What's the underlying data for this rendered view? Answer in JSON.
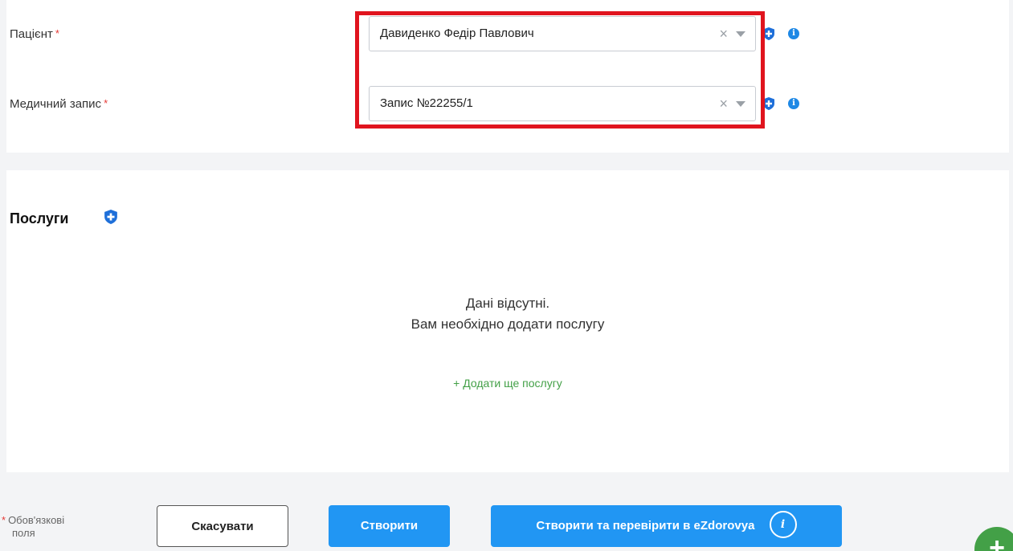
{
  "form": {
    "patient": {
      "label": "Пацієнт",
      "required_mark": "*",
      "value": "Давиденко Федір Павлович",
      "clear_glyph": "×"
    },
    "medical_record": {
      "label": "Медичний запис",
      "required_mark": "*",
      "value": "Запис №22255/1",
      "clear_glyph": "×"
    }
  },
  "services": {
    "title": "Послуги",
    "empty_line1": "Дані відсутні.",
    "empty_line2": "Вам необхідно додати послугу",
    "add_link": "+ Додати ще послугу"
  },
  "footer": {
    "required_star": "*",
    "required_line1": "Обов'язкові",
    "required_line2": "поля",
    "cancel_label": "Скасувати",
    "create_label": "Створити",
    "create_check_label": "Створити та перевірити в eZdorovya",
    "create_check_info": "i"
  },
  "fab": {
    "label": "+"
  },
  "icons": {
    "shield": "shield-plus-icon",
    "info": "info-icon",
    "dropdown": "chevron-down-icon",
    "clear": "clear-icon"
  },
  "colors": {
    "primary": "#2196f3",
    "accent_green": "#43a047",
    "highlight_red": "#e0141e",
    "required_red": "#e53935",
    "info_blue": "#1e88e5"
  }
}
